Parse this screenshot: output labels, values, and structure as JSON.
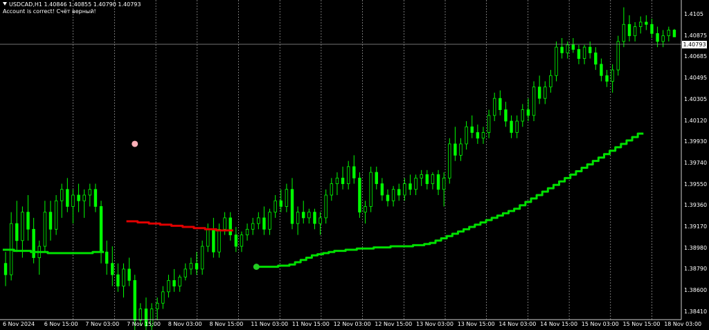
{
  "header": {
    "symbol_line": "USDCAD,H1  1.40846 1.40855 1.40790 1.40793",
    "account_line": "Account is correct! Счёт верный!"
  },
  "price_axis": {
    "labels": [
      "1.4105",
      "1.40875",
      "1.40685",
      "1.40495",
      "1.40305",
      "1.40120",
      "1.39930",
      "1.39740",
      "1.39550",
      "1.39360",
      "1.39170",
      "1.38980",
      "1.38790",
      "1.38600",
      "1.38410"
    ],
    "current_price": "1.40793"
  },
  "time_axis": {
    "labels": [
      "6 Nov 2024",
      "6 Nov 15:00",
      "7 Nov 03:00",
      "7 Nov 15:00",
      "8 Nov 03:00",
      "8 Nov 15:00",
      "11 Nov 03:00",
      "11 Nov 15:00",
      "12 Nov 03:00",
      "12 Nov 15:00",
      "13 Nov 03:00",
      "13 Nov 15:00",
      "14 Nov 03:00",
      "14 Nov 15:00",
      "15 Nov 03:00",
      "15 Nov 15:00",
      "18 Nov 03:00"
    ]
  },
  "colors": {
    "background": "#000000",
    "candle": "#00ff00",
    "grid": "#c0c0c0",
    "trend_support": "#00e000",
    "trend_resistance": "#e00000",
    "signal_dot": "#ffb0b8"
  },
  "chart_data": {
    "type": "candlestick",
    "series": [
      {
        "kind": "candles",
        "values": [
          [
            1.388,
            1.389,
            1.386,
            1.387
          ],
          [
            1.387,
            1.3925,
            1.3865,
            1.3915
          ],
          [
            1.3915,
            1.3935,
            1.389,
            1.39
          ],
          [
            1.39,
            1.393,
            1.3885,
            1.3925
          ],
          [
            1.3925,
            1.394,
            1.39,
            1.391
          ],
          [
            1.391,
            1.392,
            1.388,
            1.3885
          ],
          [
            1.3885,
            1.39,
            1.387,
            1.3895
          ],
          [
            1.3895,
            1.3935,
            1.389,
            1.3925
          ],
          [
            1.3925,
            1.3935,
            1.39,
            1.391
          ],
          [
            1.391,
            1.394,
            1.3905,
            1.3935
          ],
          [
            1.3935,
            1.395,
            1.392,
            1.3945
          ],
          [
            1.3945,
            1.3955,
            1.3925,
            1.393
          ],
          [
            1.393,
            1.3945,
            1.3915,
            1.394
          ],
          [
            1.394,
            1.395,
            1.3925,
            1.3935
          ],
          [
            1.3935,
            1.3945,
            1.392,
            1.394
          ],
          [
            1.394,
            1.395,
            1.393,
            1.3945
          ],
          [
            1.3945,
            1.395,
            1.3925,
            1.393
          ],
          [
            1.393,
            1.3935,
            1.388,
            1.389
          ],
          [
            1.389,
            1.39,
            1.387,
            1.388
          ],
          [
            1.388,
            1.3895,
            1.386,
            1.387
          ],
          [
            1.387,
            1.388,
            1.3855,
            1.386
          ],
          [
            1.386,
            1.388,
            1.385,
            1.3875
          ],
          [
            1.3875,
            1.3885,
            1.386,
            1.3865
          ],
          [
            1.3865,
            1.387,
            1.382,
            1.383
          ],
          [
            1.383,
            1.3845,
            1.3825,
            1.384
          ],
          [
            1.384,
            1.385,
            1.382,
            1.3825
          ],
          [
            1.3825,
            1.3845,
            1.381,
            1.384
          ],
          [
            1.384,
            1.385,
            1.383,
            1.3845
          ],
          [
            1.3845,
            1.386,
            1.384,
            1.3855
          ],
          [
            1.3855,
            1.387,
            1.385,
            1.3865
          ],
          [
            1.3865,
            1.3875,
            1.3855,
            1.386
          ],
          [
            1.386,
            1.387,
            1.3855,
            1.3868
          ],
          [
            1.3868,
            1.388,
            1.3865,
            1.3875
          ],
          [
            1.3875,
            1.3885,
            1.387,
            1.388
          ],
          [
            1.388,
            1.389,
            1.387,
            1.3875
          ],
          [
            1.3875,
            1.39,
            1.387,
            1.3895
          ],
          [
            1.3895,
            1.3915,
            1.389,
            1.391
          ],
          [
            1.391,
            1.392,
            1.3885,
            1.389
          ],
          [
            1.389,
            1.3915,
            1.3885,
            1.391
          ],
          [
            1.391,
            1.3925,
            1.3905,
            1.392
          ],
          [
            1.392,
            1.3925,
            1.39,
            1.3905
          ],
          [
            1.3905,
            1.3912,
            1.389,
            1.3895
          ],
          [
            1.3895,
            1.3908,
            1.389,
            1.3905
          ],
          [
            1.3905,
            1.3915,
            1.39,
            1.391
          ],
          [
            1.391,
            1.392,
            1.3905,
            1.3915
          ],
          [
            1.3915,
            1.3925,
            1.391,
            1.392
          ],
          [
            1.392,
            1.393,
            1.3905,
            1.391
          ],
          [
            1.391,
            1.3928,
            1.3905,
            1.3925
          ],
          [
            1.3925,
            1.394,
            1.392,
            1.3935
          ],
          [
            1.3935,
            1.3945,
            1.3925,
            1.393
          ],
          [
            1.393,
            1.395,
            1.3925,
            1.3945
          ],
          [
            1.3945,
            1.3955,
            1.391,
            1.3915
          ],
          [
            1.3915,
            1.393,
            1.3905,
            1.3925
          ],
          [
            1.3925,
            1.3935,
            1.3915,
            1.392
          ],
          [
            1.392,
            1.3928,
            1.3915,
            1.3925
          ],
          [
            1.3925,
            1.3928,
            1.391,
            1.3915
          ],
          [
            1.3915,
            1.3925,
            1.3905,
            1.392
          ],
          [
            1.392,
            1.3945,
            1.3915,
            1.394
          ],
          [
            1.394,
            1.3955,
            1.3935,
            1.395
          ],
          [
            1.395,
            1.396,
            1.394,
            1.3955
          ],
          [
            1.3955,
            1.3965,
            1.3945,
            1.395
          ],
          [
            1.395,
            1.397,
            1.3945,
            1.3965
          ],
          [
            1.3965,
            1.3975,
            1.395,
            1.3955
          ],
          [
            1.3955,
            1.396,
            1.392,
            1.3925
          ],
          [
            1.3925,
            1.3935,
            1.3915,
            1.393
          ],
          [
            1.393,
            1.3965,
            1.3925,
            1.396
          ],
          [
            1.396,
            1.3965,
            1.3945,
            1.395
          ],
          [
            1.395,
            1.3955,
            1.3935,
            1.394
          ],
          [
            1.394,
            1.3945,
            1.393,
            1.3935
          ],
          [
            1.3935,
            1.3948,
            1.393,
            1.3945
          ],
          [
            1.3945,
            1.395,
            1.3935,
            1.394
          ],
          [
            1.394,
            1.3955,
            1.3935,
            1.395
          ],
          [
            1.395,
            1.3958,
            1.394,
            1.3945
          ],
          [
            1.3945,
            1.3958,
            1.394,
            1.3955
          ],
          [
            1.3955,
            1.3962,
            1.3948,
            1.3958
          ],
          [
            1.3958,
            1.3962,
            1.3945,
            1.395
          ],
          [
            1.395,
            1.396,
            1.3945,
            1.3958
          ],
          [
            1.3958,
            1.3962,
            1.394,
            1.3945
          ],
          [
            1.3945,
            1.396,
            1.393,
            1.3955
          ],
          [
            1.3955,
            1.399,
            1.395,
            1.3985
          ],
          [
            1.3985,
            1.4,
            1.397,
            1.3975
          ],
          [
            1.3975,
            1.399,
            1.397,
            1.3985
          ],
          [
            1.3985,
            1.4005,
            1.398,
            1.4
          ],
          [
            1.4,
            1.401,
            1.399,
            1.3995
          ],
          [
            1.3995,
            1.4002,
            1.3985,
            1.399
          ],
          [
            1.399,
            1.4,
            1.3985,
            1.3995
          ],
          [
            1.3995,
            1.4015,
            1.399,
            1.401
          ],
          [
            1.401,
            1.403,
            1.4005,
            1.4025
          ],
          [
            1.4025,
            1.4032,
            1.401,
            1.4015
          ],
          [
            1.4015,
            1.4022,
            1.4,
            1.4005
          ],
          [
            1.4005,
            1.401,
            1.399,
            1.3995
          ],
          [
            1.3995,
            1.401,
            1.399,
            1.4005
          ],
          [
            1.4005,
            1.402,
            1.4,
            1.4015
          ],
          [
            1.4015,
            1.4025,
            1.4005,
            1.401
          ],
          [
            1.401,
            1.404,
            1.4005,
            1.4035
          ],
          [
            1.4035,
            1.4045,
            1.402,
            1.4025
          ],
          [
            1.4025,
            1.404,
            1.402,
            1.4035
          ],
          [
            1.4035,
            1.405,
            1.403,
            1.4045
          ],
          [
            1.4045,
            1.4075,
            1.404,
            1.407
          ],
          [
            1.407,
            1.4078,
            1.406,
            1.4065
          ],
          [
            1.4065,
            1.4075,
            1.406,
            1.4072
          ],
          [
            1.4072,
            1.4078,
            1.4065,
            1.4068
          ],
          [
            1.4068,
            1.4072,
            1.4055,
            1.406
          ],
          [
            1.406,
            1.4072,
            1.4055,
            1.407
          ],
          [
            1.407,
            1.4075,
            1.406,
            1.4065
          ],
          [
            1.4065,
            1.407,
            1.405,
            1.4055
          ],
          [
            1.4055,
            1.406,
            1.404,
            1.4045
          ],
          [
            1.4045,
            1.405,
            1.4035,
            1.404
          ],
          [
            1.404,
            1.4055,
            1.403,
            1.405
          ],
          [
            1.405,
            1.408,
            1.4045,
            1.4075
          ],
          [
            1.4075,
            1.4105,
            1.407,
            1.409
          ],
          [
            1.409,
            1.4098,
            1.4075,
            1.408
          ],
          [
            1.408,
            1.4092,
            1.4075,
            1.4088
          ],
          [
            1.4088,
            1.4097,
            1.4082,
            1.4092
          ],
          [
            1.4092,
            1.4098,
            1.4085,
            1.409
          ],
          [
            1.409,
            1.4095,
            1.4078,
            1.4082
          ],
          [
            1.4082,
            1.4088,
            1.407,
            1.4075
          ],
          [
            1.4075,
            1.4085,
            1.407,
            1.408
          ],
          [
            1.408,
            1.4088,
            1.4075,
            1.4085
          ],
          [
            1.4085,
            1.4086,
            1.4079,
            1.4079
          ]
        ]
      },
      {
        "kind": "step_line",
        "name": "",
        "color": "#00e000",
        "segment": 1,
        "values": [
          1.3892,
          1.3892,
          1.3891,
          1.3891,
          1.3891,
          1.389,
          1.389,
          1.389,
          1.3889,
          1.3889,
          1.3889,
          1.3889,
          1.3889,
          1.3889,
          1.3889,
          1.3889,
          1.389,
          1.389
        ]
      },
      {
        "kind": "step_line",
        "name": "",
        "color": "#e00000",
        "segment": 2,
        "values": [
          1.3917,
          1.3917,
          1.3916,
          1.3916,
          1.3915,
          1.3915,
          1.3914,
          1.3914,
          1.3913,
          1.3913,
          1.3912,
          1.3912,
          1.3911,
          1.3911,
          1.391,
          1.391,
          1.3909,
          1.3909,
          1.3909
        ]
      },
      {
        "kind": "step_line",
        "name": "",
        "color": "#00e000",
        "segment": 3,
        "values": [
          1.3877,
          1.3877,
          1.3877,
          1.3877,
          1.3878,
          1.3878,
          1.3879,
          1.3881,
          1.3883,
          1.3885,
          1.3887,
          1.3888,
          1.3889,
          1.389,
          1.3891,
          1.3891,
          1.3892,
          1.3892,
          1.3893,
          1.3893,
          1.3893,
          1.3894,
          1.3894,
          1.3894,
          1.3895,
          1.3895,
          1.3895,
          1.3895,
          1.3896,
          1.3896,
          1.3897,
          1.3898,
          1.39,
          1.3902,
          1.3904,
          1.3906,
          1.3908,
          1.391,
          1.3912,
          1.3914,
          1.3916,
          1.3918,
          1.392,
          1.3922,
          1.3924,
          1.3926,
          1.3928,
          1.3931,
          1.3934,
          1.3937,
          1.394,
          1.3943,
          1.3946,
          1.3949,
          1.3952,
          1.3955,
          1.3958,
          1.3961,
          1.3964,
          1.3967,
          1.397,
          1.3973,
          1.3976,
          1.3979,
          1.3982,
          1.3985,
          1.3988,
          1.3991,
          1.3994
        ]
      }
    ],
    "markers": [
      {
        "name": "signal-dot-pink",
        "price": 1.3985,
        "color": "#ffb0b8"
      },
      {
        "name": "signal-dot-green",
        "price": 1.3877,
        "color": "#22cc22"
      }
    ],
    "ylim": [
      1.3833,
      1.4109
    ],
    "grid": true
  }
}
